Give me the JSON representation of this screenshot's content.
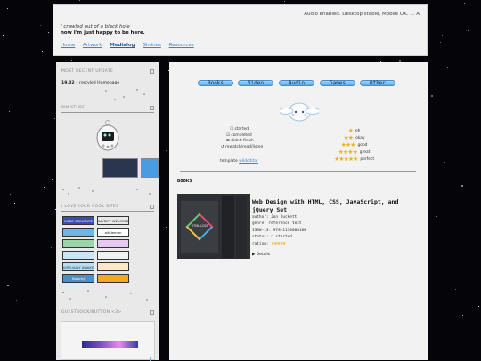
{
  "header": {
    "ticker": "Audio enabled. Desktop stable, Mobile OK. ... A",
    "tagline_line1": "I crawled out of a black hole",
    "tagline_line2": "now I'm just happy to be here.",
    "nav": [
      "Home",
      "Artwork",
      "Medialog",
      "Shrines",
      "Resources"
    ],
    "active_nav": "Medialog"
  },
  "sidebar": {
    "recent_update_title": "MOST RECENT UPDATE",
    "recent_update_date": "19.02",
    "recent_update_text": "• restyled Homepage",
    "pin_title": "PIN STUFF",
    "cool_sites_title": "I LOVE YOUR COOL SITES",
    "site_buttons": [
      "CODE CREATURE",
      "WAYRIFT WELCOME",
      "",
      "alfalemon",
      "",
      "",
      "",
      "",
      "VIRTUALLY AWAKE",
      "",
      "floramy",
      ""
    ],
    "guestbook_title": "GUESTBOOK/BUTTON <3>"
  },
  "main": {
    "tabs": [
      "Books",
      "Video",
      "Audio",
      "Games",
      "Other"
    ],
    "legend": [
      "☐ started",
      "☑ completed",
      "⊠ didn't finish",
      "↺ rewatch/read/listen"
    ],
    "template_prefix": "template",
    "template_link": "wildcititar",
    "ratings": [
      {
        "stars": "★",
        "label": "eh"
      },
      {
        "stars": "★★",
        "label": "okay"
      },
      {
        "stars": "★★★",
        "label": "good"
      },
      {
        "stars": "★★★★",
        "label": "great"
      },
      {
        "stars": "★★★★★",
        "label": "perfect"
      }
    ],
    "section_title": "BOOKS",
    "book": {
      "title": "Web Design with HTML, CSS, JavaScript, and jQuery Set",
      "author": "author: Jon Duckett",
      "genre": "genre: reference text",
      "isbn": "ISBN-13: 978-1118008188",
      "status": "status: ☐ started",
      "rating_label": "rating:",
      "rating_stars": "★★★★★",
      "details": "▶ Details",
      "cover_title": "HTML&CSS"
    }
  }
}
